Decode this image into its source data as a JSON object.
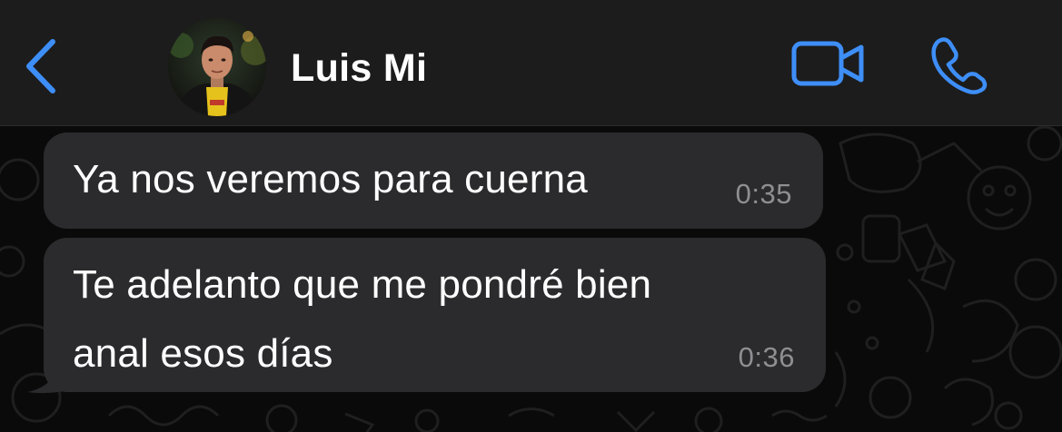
{
  "header": {
    "back_icon": "chevron-left-icon",
    "contact_name": "Luis Mi",
    "video_icon": "video-camera-icon",
    "call_icon": "phone-icon"
  },
  "messages": [
    {
      "text": "Ya nos veremos para cuerna",
      "time": "0:35",
      "direction": "incoming"
    },
    {
      "text": "Te adelanto que me pondré bien anal esos días",
      "line1": "Te adelanto que me pondré bien",
      "line2": "anal esos días",
      "time": "0:36",
      "direction": "incoming"
    }
  ],
  "colors": {
    "accent": "#3e8ef7",
    "header_bg": "#1c1c1c",
    "bubble_bg": "#2b2b2d",
    "chat_bg": "#0a0a0a",
    "timestamp": "#8e8e93"
  }
}
